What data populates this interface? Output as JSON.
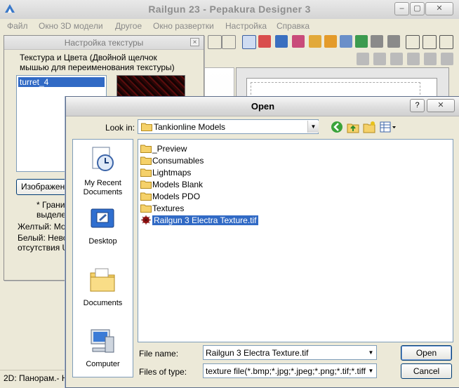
{
  "main_window": {
    "title": "Railgun 23 - Pepakura Designer 3",
    "menu": [
      "Файл",
      "Окно 3D модели",
      "Другое",
      "Окно развертки",
      "Настройка",
      "Справка"
    ],
    "status": "2D: Панорам.- Н"
  },
  "texture_panel": {
    "title": "Настройка текстуры",
    "heading_line1": "Текстура и Цвета (Двойной щелчок",
    "heading_line2": "мышью для переименования текстуры)",
    "textures": [
      "turret_4"
    ],
    "image_button": "Изображен",
    "note_line1": "* Грани",
    "note_line2": "выделен",
    "yellow_label": "Желтый: Мож",
    "white_label_line1": "Белый:  Невоз",
    "white_label_line2": "отсутствия U"
  },
  "dialog": {
    "title": "Open",
    "help_glyph": "?",
    "close_glyph": "✕",
    "look_in_label": "Look in:",
    "look_in_value": "Tankionline Models",
    "places": [
      "My Recent Documents",
      "Desktop",
      "Documents",
      "Computer"
    ],
    "files": [
      {
        "name": "_Preview",
        "type": "folder"
      },
      {
        "name": "Consumables",
        "type": "folder"
      },
      {
        "name": "Lightmaps",
        "type": "folder"
      },
      {
        "name": "Models Blank",
        "type": "folder"
      },
      {
        "name": "Models PDO",
        "type": "folder"
      },
      {
        "name": "Textures",
        "type": "folder"
      },
      {
        "name": "Railgun 3 Electra Texture.tif",
        "type": "image",
        "selected": true
      }
    ],
    "file_name_label": "File name:",
    "file_name_value": "Railgun 3 Electra Texture.tif",
    "file_type_label": "Files of type:",
    "file_type_value": "texture file(*.bmp;*.jpg;*.jpeg;*.png;*.tif;*.tiff,*tga)",
    "open_button": "Open",
    "cancel_button": "Cancel"
  },
  "colors": {
    "selection": "#316ac5",
    "folder": "#f5d16a",
    "dialog_bg": "#ece9d8"
  }
}
